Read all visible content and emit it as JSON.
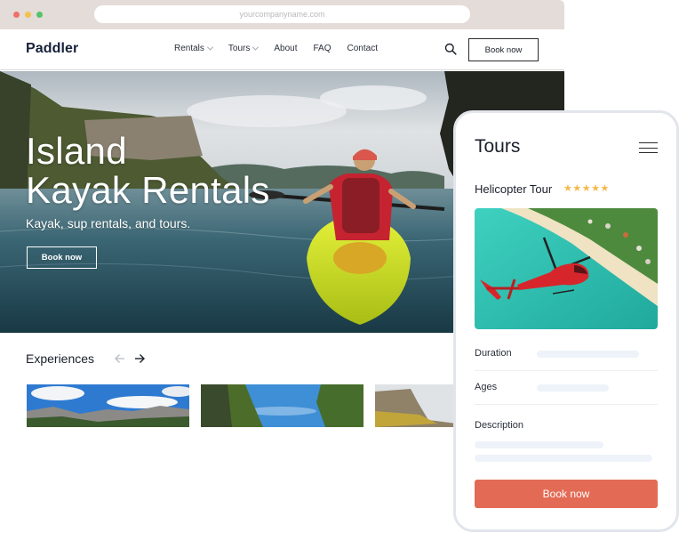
{
  "browser": {
    "url": "yourcompanyname.com",
    "window_controls": [
      "close",
      "minimize",
      "maximize"
    ]
  },
  "site": {
    "logo": "Paddler",
    "nav": [
      {
        "label": "Rentals",
        "has_dropdown": true
      },
      {
        "label": "Tours",
        "has_dropdown": true
      },
      {
        "label": "About",
        "has_dropdown": false
      },
      {
        "label": "FAQ",
        "has_dropdown": false
      },
      {
        "label": "Contact",
        "has_dropdown": false
      }
    ],
    "search_icon": "search-icon",
    "book_button": "Book now"
  },
  "hero": {
    "title_line1": "Island",
    "title_line2": "Kayak Rentals",
    "subtitle": "Kayak, sup rentals, and tours.",
    "button": "Book now"
  },
  "experiences": {
    "title": "Experiences",
    "prev_icon": "arrow-left-icon",
    "next_icon": "arrow-right-icon",
    "thumbnails": [
      {
        "alt": "Mountain range under cloudy blue sky"
      },
      {
        "alt": "Blue sky between jungle cliffs"
      },
      {
        "alt": "Limestone cliff at sunset"
      }
    ]
  },
  "mobile": {
    "title": "Tours",
    "menu_icon": "hamburger-menu-icon",
    "tour": {
      "name": "Helicopter Tour",
      "stars": "★★★★★",
      "rating": 5,
      "image_alt": "Red helicopter over turquoise beach"
    },
    "fields": [
      {
        "label": "Duration"
      },
      {
        "label": "Ages"
      },
      {
        "label": "Description"
      }
    ],
    "book_button": "Book now"
  },
  "colors": {
    "chrome_bg": "#e4dcd9",
    "accent_button": "#e36b55",
    "star": "#f6b84a",
    "placeholder_bar": "#eef3f9",
    "phone_frame": "#e2e5ec"
  }
}
